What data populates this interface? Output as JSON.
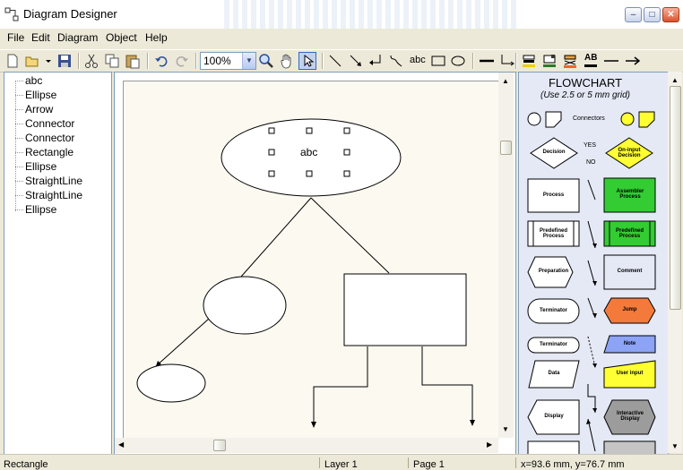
{
  "window": {
    "title": "Diagram Designer",
    "min": "–",
    "max": "□",
    "close": "✕"
  },
  "menu": [
    "File",
    "Edit",
    "Diagram",
    "Object",
    "Help"
  ],
  "toolbar": {
    "zoom": "100%",
    "text_tool": "abc",
    "font_tool": "AB"
  },
  "tree": [
    "abc",
    "Ellipse",
    "Arrow",
    "Connector",
    "Connector",
    "Rectangle",
    "Ellipse",
    "StraightLine",
    "StraightLine",
    "Ellipse"
  ],
  "canvas": {
    "ellipse_text": "abc"
  },
  "palette": {
    "title": "FLOWCHART",
    "subtitle": "(Use 2.5 or 5 mm grid)",
    "connectors": "Connectors",
    "yes": "YES",
    "no": "NO",
    "decision": "Decision",
    "on_input_decision": "On-input Decision",
    "process": "Process",
    "assembler_process": "Assembler Process",
    "predefined_process": "Predefined Process",
    "predefined_process_green": "Predefined Process",
    "preparation": "Preparation",
    "comment": "Comment",
    "terminator1": "Terminator",
    "jump": "Jump",
    "terminator2": "Terminator",
    "note": "Note",
    "data": "Data",
    "user_input": "User input",
    "display": "Display",
    "interactive_display": "Interactive Display",
    "colors": {
      "yellow": "#ffff33",
      "green": "#33cc33",
      "orange": "#f47a3c",
      "blue": "#8da3f5",
      "gray": "#9c9c9c"
    }
  },
  "status": {
    "object": "Rectangle",
    "layer": "Layer 1",
    "page": "Page 1",
    "coords": "x=93.6 mm, y=76.7 mm"
  }
}
